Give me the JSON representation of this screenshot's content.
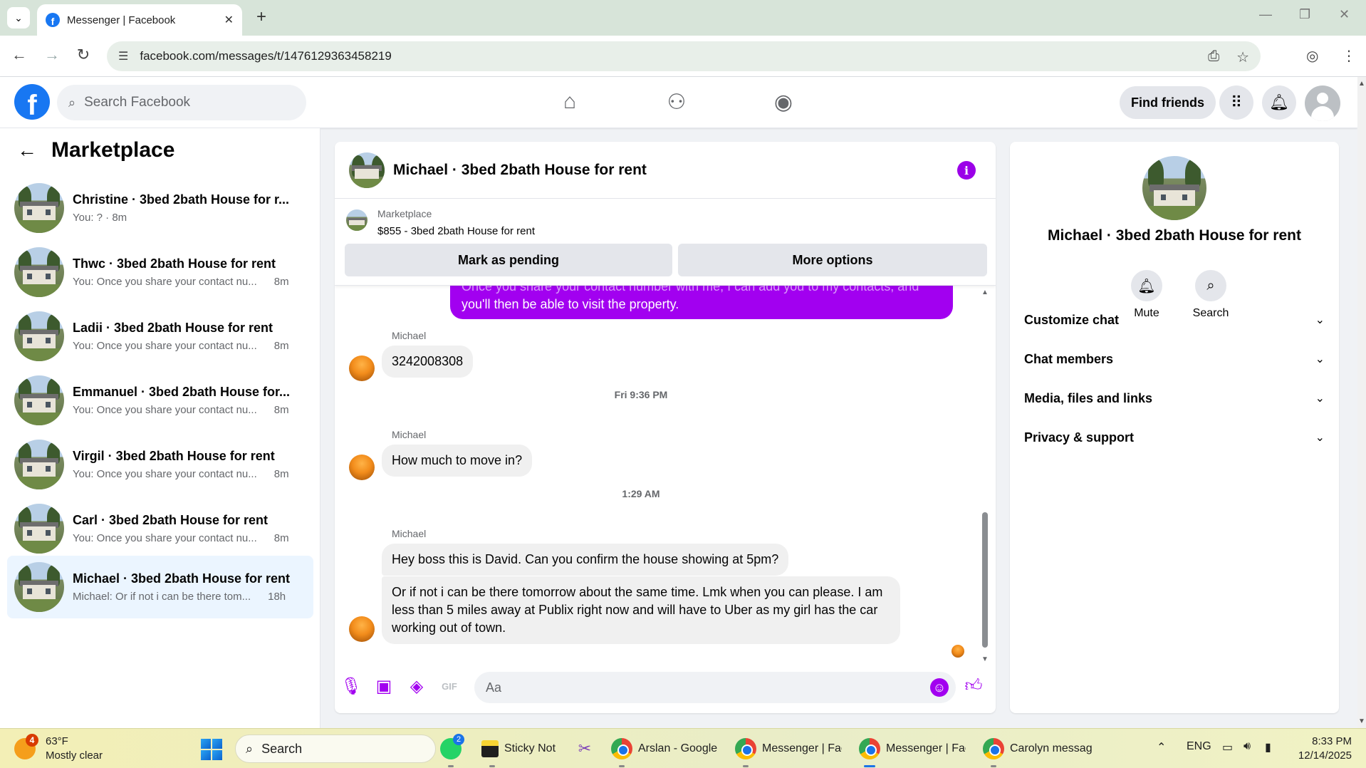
{
  "browser": {
    "tab_title": "Messenger | Facebook",
    "url": "facebook.com/messages/t/1476129363458219"
  },
  "header": {
    "search_placeholder": "Search Facebook",
    "find_friends": "Find friends"
  },
  "sidebar": {
    "title": "Marketplace",
    "conversations": [
      {
        "name": "Christine · 3bed 2bath House for r...",
        "preview": "You: ? · 8m",
        "time": ""
      },
      {
        "name": "Thwc · 3bed 2bath House for rent",
        "preview": "You: Once you share your contact nu...",
        "time": "8m"
      },
      {
        "name": "Ladii · 3bed 2bath House for rent",
        "preview": "You: Once you share your contact nu...",
        "time": "8m"
      },
      {
        "name": "Emmanuel · 3bed 2bath House for...",
        "preview": "You: Once you share your contact nu...",
        "time": "8m"
      },
      {
        "name": "Virgil · 3bed 2bath House for rent",
        "preview": "You: Once you share your contact nu...",
        "time": "8m"
      },
      {
        "name": "Carl · 3bed 2bath House for rent",
        "preview": "You: Once you share your contact nu...",
        "time": "8m"
      },
      {
        "name": "Michael · 3bed 2bath House for rent",
        "preview": "Michael: Or if not i can be there tom...",
        "time": "18h"
      }
    ]
  },
  "chat": {
    "title": "Michael · 3bed 2bath House for rent",
    "marketplace_label": "Marketplace",
    "listing": "$855 - 3bed 2bath House for rent",
    "mark_pending": "Mark as pending",
    "more_options": "More options",
    "outgoing_partial": "Once you share your contact number with me, I can add you to my contacts, and",
    "outgoing_last": "you'll then be able to visit the property.",
    "sender": "Michael",
    "msg_phone": "3242008308",
    "ts1": "Fri 9:36 PM",
    "msg_move": "How much to move in?",
    "ts2": "1:29 AM",
    "msg_boss": "Hey boss this is David. Can you confirm the house showing at 5pm?",
    "msg_tomorrow": "Or if not i can be there tomorrow about the same time. Lmk when you can please. I am less than 5 miles away at Publix right now and will have to Uber as my girl has the car working out of town.",
    "composer_placeholder": "Aa"
  },
  "info_panel": {
    "name": "Michael · 3bed 2bath House for rent",
    "mute": "Mute",
    "search": "Search",
    "sections": [
      "Customize chat",
      "Chat members",
      "Media, files and links",
      "Privacy & support"
    ]
  },
  "taskbar": {
    "temp": "63°F",
    "condition": "Mostly clear",
    "weather_badge": "4",
    "search": "Search",
    "whatsapp_badge": "2",
    "apps": [
      "Sticky Not",
      "Arslan - Google",
      "Messenger | Fac",
      "Messenger | Fac",
      "Carolyn messag"
    ],
    "lang": "ENG",
    "time": "8:33 PM",
    "date": "12/14/2025"
  },
  "colors": {
    "fb_blue": "#1877f2",
    "messenger_purple": "#a200f0",
    "active_convo": "#ebf5ff"
  }
}
